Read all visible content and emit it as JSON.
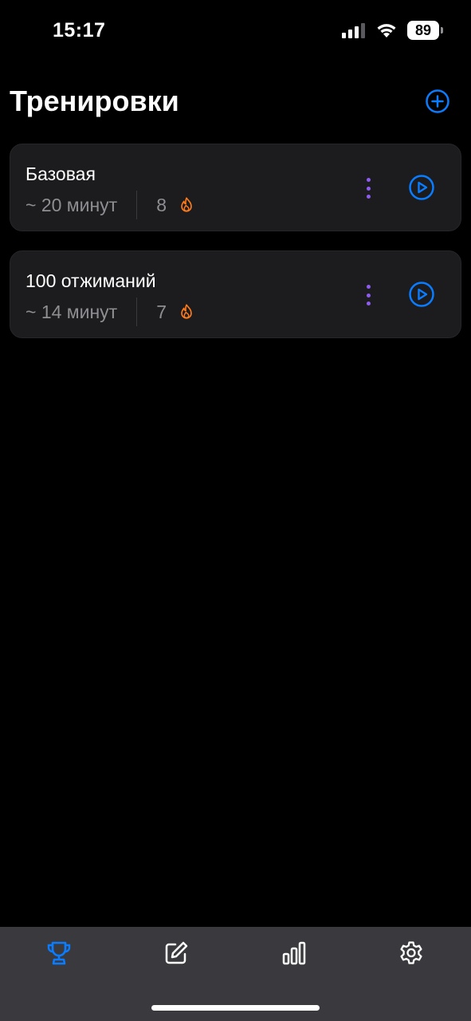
{
  "status_bar": {
    "time": "15:17",
    "battery": "89",
    "icons": [
      "cellular-signal-icon",
      "wifi-icon",
      "battery-icon"
    ]
  },
  "header": {
    "title": "Тренировки",
    "add_icon": "plus-circle-icon"
  },
  "workouts": [
    {
      "title": "Базовая",
      "duration": "~ 20 минут",
      "count": "8"
    },
    {
      "title": "100 отжиманий",
      "duration": "~ 14 минут",
      "count": "7"
    }
  ],
  "tab_bar": {
    "tabs": [
      {
        "icon": "trophy-icon",
        "active": true
      },
      {
        "icon": "edit-icon",
        "active": false
      },
      {
        "icon": "stats-icon",
        "active": false
      },
      {
        "icon": "settings-icon",
        "active": false
      }
    ]
  },
  "colors": {
    "background": "#000000",
    "card": "#1c1c1e",
    "accent": "#0a7cff",
    "menu_dots": "#8e5cf0",
    "fire": "#ff7a1a",
    "secondary_text": "#8e8e93",
    "tab_bar": "#3a3a3e"
  }
}
